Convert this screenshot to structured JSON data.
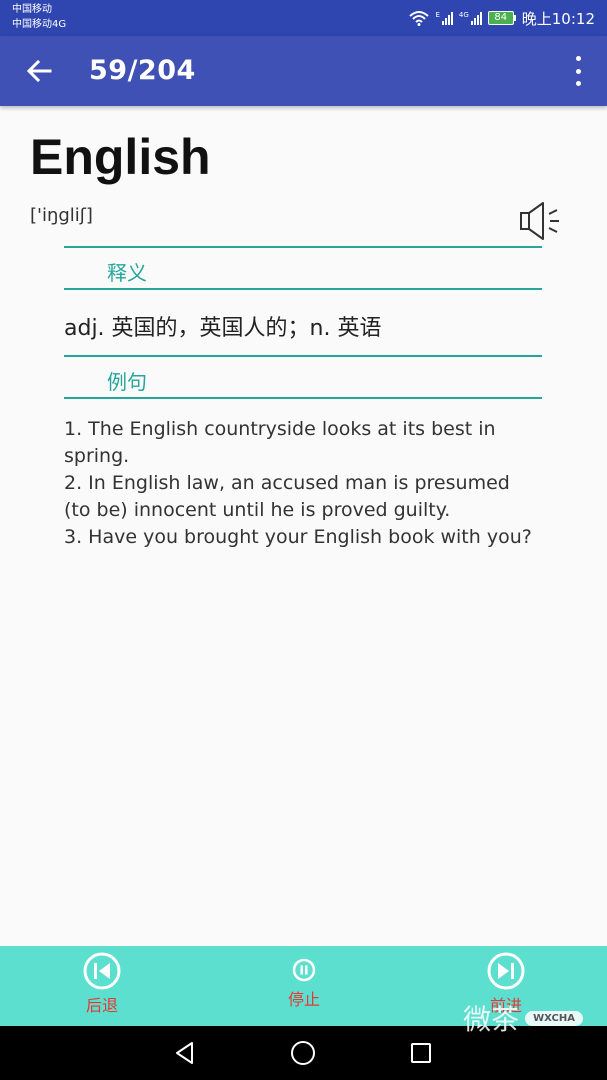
{
  "status_bar": {
    "carrier_1": "中国移动",
    "carrier_2": "中国移动4G",
    "sig1_tag": "E",
    "sig2_tag": "4G",
    "battery": "84",
    "time": "晚上10:12",
    "battery_color": "#4caf50"
  },
  "app_bar": {
    "counter": "59/204",
    "color": "#3f51b5"
  },
  "entry": {
    "word": "English",
    "phonetic": "['iŋgliʃ]",
    "definition_header": "释义",
    "definition": "adj. 英国的，英国人的；n. 英语",
    "examples_header": "例句",
    "examples": [
      "1. The English countryside looks at its best in spring.",
      "2. In English law, an accused man is presumed (to be) innocent until he is proved guilty.",
      "3. Have you brought your English book with you?"
    ]
  },
  "controls": {
    "prev": "后退",
    "stop": "停止",
    "next": "前进",
    "bar_color": "#5ddfcf",
    "label_color": "#e53935"
  },
  "watermark": {
    "text": "微茶",
    "tag": "WXCHA"
  }
}
